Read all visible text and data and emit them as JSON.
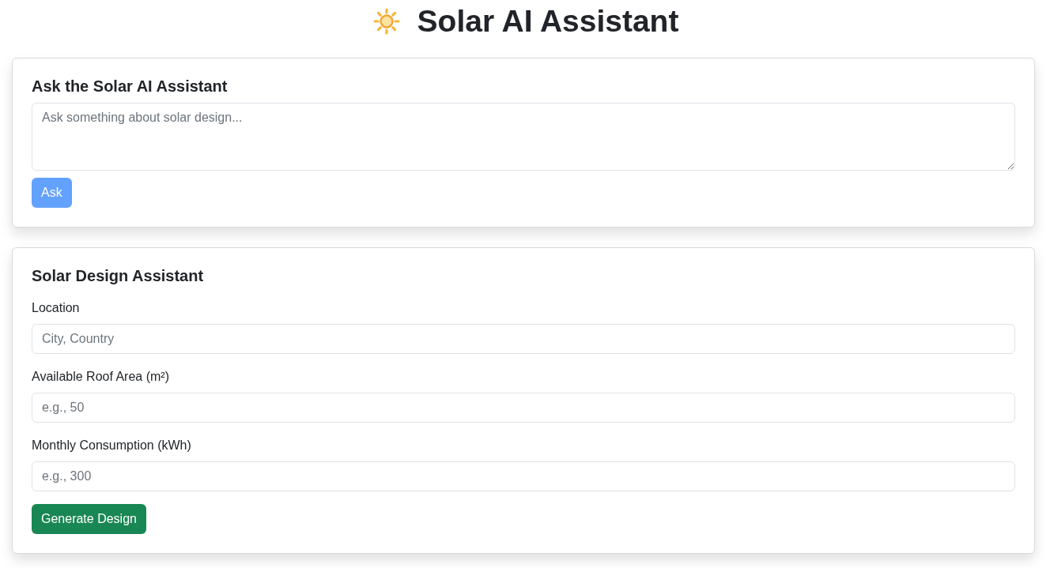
{
  "header": {
    "title": "Solar AI Assistant"
  },
  "ask_panel": {
    "heading": "Ask the Solar AI Assistant",
    "question": {
      "placeholder": "Ask something about solar design..."
    },
    "ask_button": {
      "label": "Ask",
      "disabled": true
    }
  },
  "design_panel": {
    "heading": "Solar Design Assistant",
    "fields": [
      {
        "label": "Location",
        "placeholder": "City, Country"
      },
      {
        "label": "Available Roof Area (m²)",
        "placeholder": "e.g., 50"
      },
      {
        "label": "Monthly Consumption (kWh)",
        "placeholder": "e.g., 300"
      }
    ],
    "generate_button": {
      "label": "Generate Design",
      "disabled": false
    }
  }
}
